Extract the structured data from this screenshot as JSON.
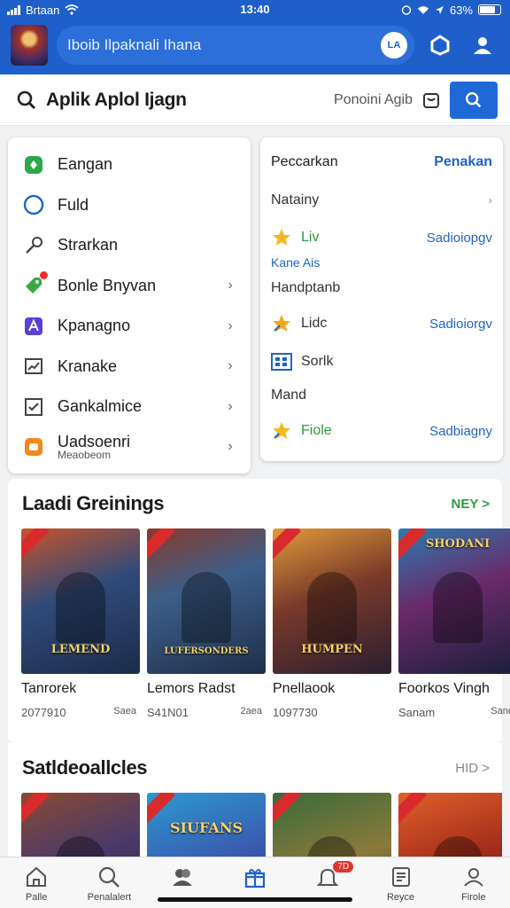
{
  "status_bar": {
    "carrier": "Brtaan",
    "time": "13:40",
    "battery": "63%"
  },
  "header": {
    "search_text": "Iboib Ilpaknali Ihana",
    "badge_text": "LA"
  },
  "search": {
    "query": "Aplik Aplol Ijagn",
    "hint": "Ponoini Agib"
  },
  "menu": {
    "items": [
      {
        "label": "Eangan",
        "icon": "green-square-icon",
        "chevron": false
      },
      {
        "label": "Fuld",
        "icon": "circle-icon",
        "chevron": false
      },
      {
        "label": "Strarkan",
        "icon": "wrench-icon",
        "chevron": false
      },
      {
        "label": "Bonle Bnyvan",
        "icon": "tag-icon",
        "chevron": true
      },
      {
        "label": "Kpanagno",
        "icon": "purple-a-icon",
        "chevron": true
      },
      {
        "label": "Kranake",
        "icon": "chart-icon",
        "chevron": true
      },
      {
        "label": "Gankalmice",
        "icon": "checkbox-icon",
        "chevron": true
      },
      {
        "label": "Uadsoenri",
        "sub": "Meaobeom",
        "icon": "orange-app-icon",
        "chevron": true
      }
    ]
  },
  "right_panel": {
    "header_left": "Peccarkan",
    "header_action": "Penakan",
    "row1": "Natainy",
    "row2_label": "Liv",
    "row2_link": "Sadioiopgv",
    "small_link": "Kane Ais",
    "row3": "Handptanb",
    "row4_label": "Lidc",
    "row4_link": "Sadioiorgv",
    "row5_label": "Sorlk",
    "row6": "Mand",
    "row7_label": "Fiole",
    "row7_link": "Sadbiagny"
  },
  "section1": {
    "title": "Laadi Greinings",
    "more": "NEY >",
    "games": [
      {
        "title": "Tanrorek",
        "meta": "2077910",
        "meta_right": "Saea",
        "cover_text": "LEMEND"
      },
      {
        "title": "Lemors Radst",
        "meta": "S41N01",
        "meta_right": "2aea",
        "cover_text": "LUFERSONDERS"
      },
      {
        "title": "Pnellaook",
        "meta": "1097730",
        "meta_right": "",
        "cover_text": "HUMPEN"
      },
      {
        "title": "Foorkos Vingh",
        "meta": "Sanam",
        "meta_right": "Sane",
        "cover_text": "SHODANI"
      }
    ]
  },
  "section2": {
    "title": "Satldeoallcles",
    "more": "HID >",
    "games": [
      {
        "cover_text": ""
      },
      {
        "cover_text": "SIUFANS"
      },
      {
        "cover_text": ""
      },
      {
        "cover_text": ""
      }
    ]
  },
  "bottom_nav": [
    {
      "label": "Palle",
      "icon": "home-icon"
    },
    {
      "label": "Penalalert",
      "icon": "search-icon"
    },
    {
      "label": "",
      "icon": "people-icon"
    },
    {
      "label": "",
      "icon": "gift-icon"
    },
    {
      "label": "",
      "icon": "bell-icon",
      "badge": "7D"
    },
    {
      "label": "Reyce",
      "icon": "receipt-icon"
    },
    {
      "label": "Firole",
      "icon": "profile-icon"
    }
  ],
  "colors": {
    "brand_blue": "#1f5fc9",
    "link_blue": "#1f63c8",
    "accent_green": "#2c9a3c",
    "badge_red": "#e3322b"
  }
}
